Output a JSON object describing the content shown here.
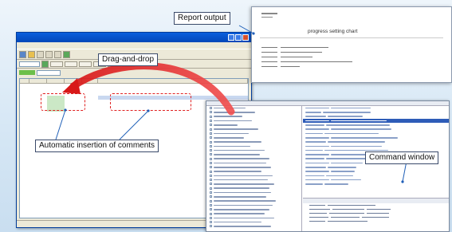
{
  "callouts": {
    "report_output": "Report output",
    "drag_and_drop": "Drag-and-drop",
    "auto_insertion": "Automatic insertion of comments",
    "command_window": "Command window"
  },
  "report_window": {
    "title": "progress setting chart"
  },
  "colors": {
    "dashed_box": "#e02020",
    "arrow": "#e83030",
    "titlebar": "#0a5fdc",
    "callout_line": "#1f5fb8"
  }
}
